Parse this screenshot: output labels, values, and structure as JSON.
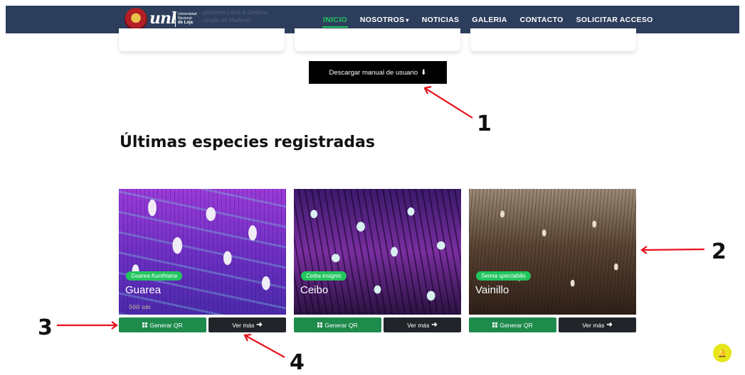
{
  "navbar": {
    "logo_text": "unl",
    "university_lines": [
      "Universidad",
      "Nacional",
      "de Loja"
    ],
    "ghost_left_lines": [
      "...gaciones Leiva & Grafeos",
      "...iología de Maderas"
    ],
    "ghost_mid_line": "...",
    "links": [
      {
        "label": "INICIO",
        "active": true
      },
      {
        "label": "NOSOTROS",
        "dropdown": true
      },
      {
        "label": "NOTICIAS"
      },
      {
        "label": "GALERIA"
      },
      {
        "label": "CONTACTO"
      },
      {
        "label": "SOLICITAR ACCESO"
      }
    ],
    "caret_glyph": "▾"
  },
  "download_button": {
    "label": "Descargar manual de usuario",
    "icon": "download-icon",
    "glyph": "⬇"
  },
  "section_title": "Últimas especies registradas",
  "species": [
    {
      "tag": "Guarea Kunthiana",
      "name": "Guarea",
      "image_label": "500 um",
      "qr_label": "Generar QR",
      "more_label": "Ver más"
    },
    {
      "tag": "Ceiba insignis",
      "name": "Ceibo",
      "qr_label": "Generar QR",
      "more_label": "Ver más"
    },
    {
      "tag": "Senna spectabilis",
      "name": "Vainillo",
      "qr_label": "Generar QR",
      "more_label": "Ver más"
    }
  ],
  "arrow_glyph": "➜",
  "annotations": [
    "1",
    "2",
    "3",
    "4"
  ],
  "notification": {
    "icon": "bell-icon",
    "glyph": "🔔"
  },
  "colors": {
    "navbar": "#2c3e5c",
    "active_link": "#22c55e",
    "qr_button": "#1e8a4c",
    "more_button": "#212529",
    "annotation_arrow": "#e8101a",
    "notification": "#e6e619"
  }
}
